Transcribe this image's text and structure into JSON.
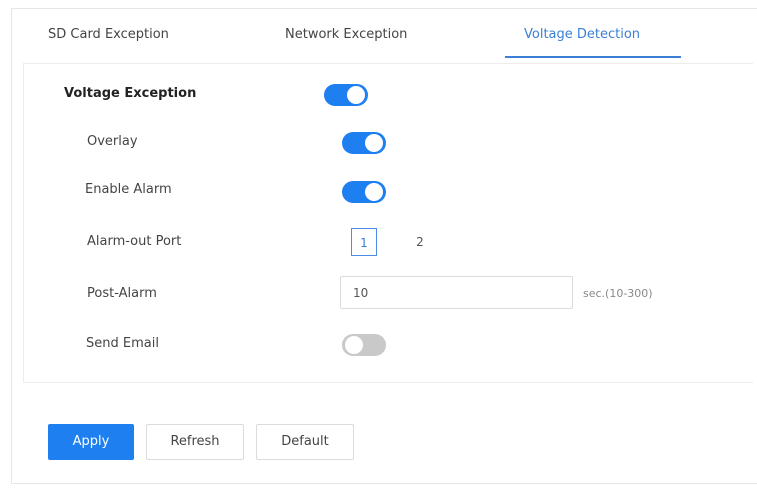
{
  "tabs": [
    {
      "label": "SD Card Exception",
      "active": false
    },
    {
      "label": "Network Exception",
      "active": false
    },
    {
      "label": "Voltage Detection",
      "active": true
    }
  ],
  "voltage_exception": {
    "label": "Voltage Exception",
    "enabled": true
  },
  "overlay": {
    "label": "Overlay",
    "enabled": true
  },
  "enable_alarm": {
    "label": "Enable Alarm",
    "enabled": true
  },
  "alarm_out_port": {
    "label": "Alarm-out Port",
    "ports": [
      "1",
      "2"
    ],
    "selected": "1"
  },
  "post_alarm": {
    "label": "Post-Alarm",
    "value": "10",
    "hint": "sec.(10-300)"
  },
  "send_email": {
    "label": "Send Email",
    "enabled": false
  },
  "buttons": {
    "apply": "Apply",
    "refresh": "Refresh",
    "default": "Default"
  },
  "colors": {
    "accent": "#1e7ff0",
    "tab_active": "#3b7fd6",
    "toggle_off": "#c9c9c9"
  }
}
